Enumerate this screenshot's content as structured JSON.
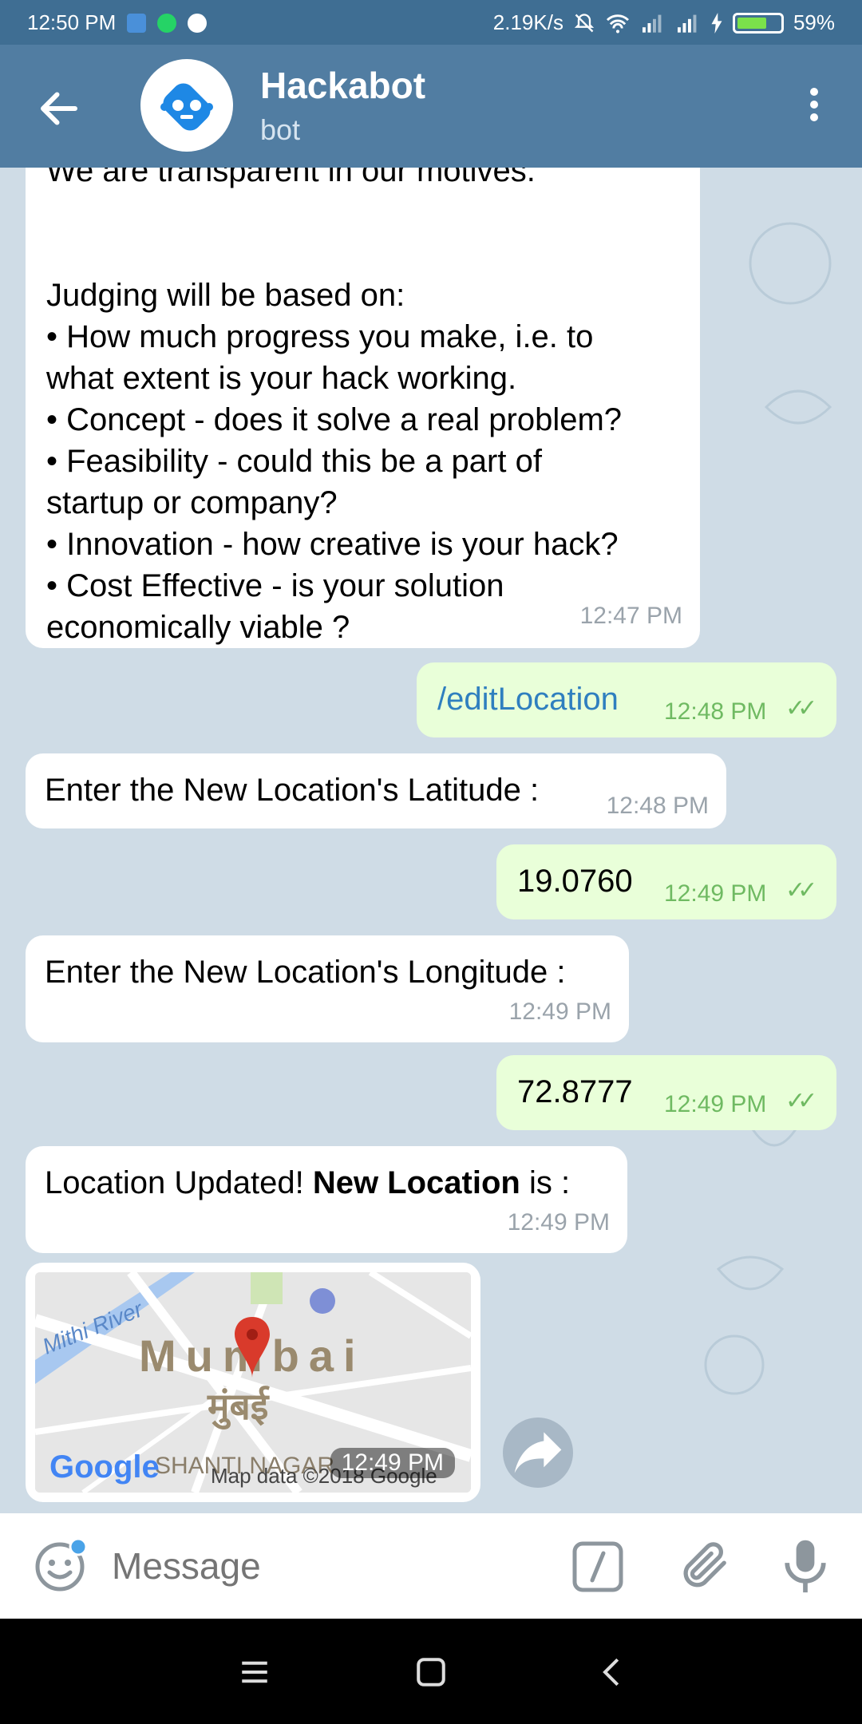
{
  "status_bar": {
    "time": "12:50 PM",
    "net_speed": "2.19K/s",
    "battery": "59%"
  },
  "header": {
    "title": "Hackabot",
    "subtitle": "bot"
  },
  "messages": [
    {
      "direction": "in",
      "lines": [
        "We are transparent in our motives.",
        "",
        "",
        "Judging will be based on:",
        "• How much progress you make, i.e. to",
        "what extent is your hack working.",
        "• Concept - does it solve a real problem?",
        "• Feasibility - could this be a part of",
        "startup or company?",
        "• Innovation - how creative is your hack?",
        "• Cost Effective - is your solution",
        "economically viable ?"
      ],
      "time": "12:47 PM"
    },
    {
      "direction": "out",
      "text": "/editLocation",
      "time": "12:48 PM"
    },
    {
      "direction": "in",
      "text": "Enter the New Location's Latitude :",
      "time": "12:48 PM"
    },
    {
      "direction": "out",
      "text": "19.0760",
      "time": "12:49 PM"
    },
    {
      "direction": "in",
      "text": "Enter the New Location's Longitude :",
      "time": "12:49 PM"
    },
    {
      "direction": "out",
      "text": "72.8777",
      "time": "12:49 PM"
    },
    {
      "direction": "in",
      "text_prefix": "Location Updated! ",
      "text_bold": "New Location",
      "text_suffix": " is :",
      "time": "12:49 PM"
    }
  ],
  "map": {
    "river": "Mithi River",
    "city_en": "Mumbai",
    "city_hi": "मुंबई",
    "area": "SHANTI NAGAR",
    "google": "Google",
    "attribution": "Map data ©2018 Google",
    "time": "12:49 PM"
  },
  "composer": {
    "placeholder": "Message"
  },
  "colors": {
    "header": "#517da2",
    "status_bar": "#3f6e93",
    "outgoing_bubble": "#e9ffd9",
    "incoming_bubble": "#ffffff",
    "chat_bg": "#cfdce6",
    "check_green": "#6fba62"
  },
  "icons": {
    "back": "arrow-left-icon",
    "menu": "more-vertical-icon",
    "emoji": "smile-icon",
    "command": "slash-command-icon",
    "attach": "paperclip-icon",
    "mic": "microphone-icon",
    "share": "share-arrow-icon"
  }
}
